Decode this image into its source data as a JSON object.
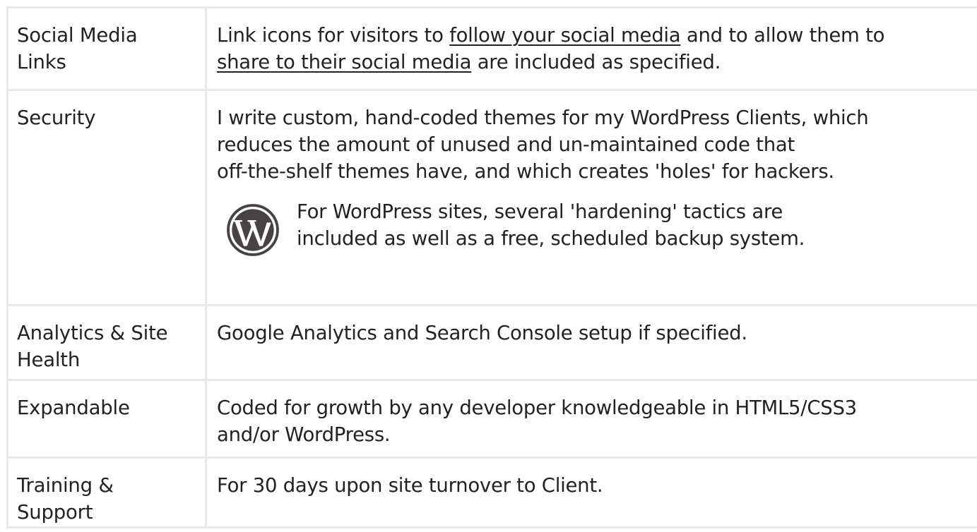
{
  "rows": [
    {
      "label_lines": [
        "Social Media",
        "Links"
      ],
      "desc": {
        "line1_pre": "Link icons for visitors to ",
        "line1_link": "follow your social media",
        "line1_post": " and to allow them to",
        "line2_link": "share to their social media",
        "line2_post": " are included as specified."
      }
    },
    {
      "label_lines": [
        "Security"
      ],
      "desc_lines": [
        "I write custom, hand-coded themes for my WordPress Clients, which",
        "reduces the amount of unused and un-maintained code that",
        "off-the-shelf themes have, and which creates 'holes' for hackers."
      ],
      "wp_note": {
        "icon": "wordpress-logo-icon",
        "lines": [
          "For WordPress sites, several 'hardening' tactics are",
          "included as well as a free, scheduled backup system."
        ]
      }
    },
    {
      "label_lines": [
        "Analytics & Site",
        "Health"
      ],
      "desc_lines": [
        "Google Analytics and Search Console setup if specified."
      ]
    },
    {
      "label_lines": [
        "Expandable"
      ],
      "desc_lines": [
        "Coded for growth by any developer knowledgeable in HTML5/CSS3",
        "and/or WordPress."
      ]
    },
    {
      "label_lines": [
        "Training &",
        "Support"
      ],
      "desc_lines": [
        "For 30 days upon site turnover to Client."
      ]
    }
  ],
  "colors": {
    "text": "#222222",
    "border": "#e8e8e8",
    "icon": "#464342"
  }
}
